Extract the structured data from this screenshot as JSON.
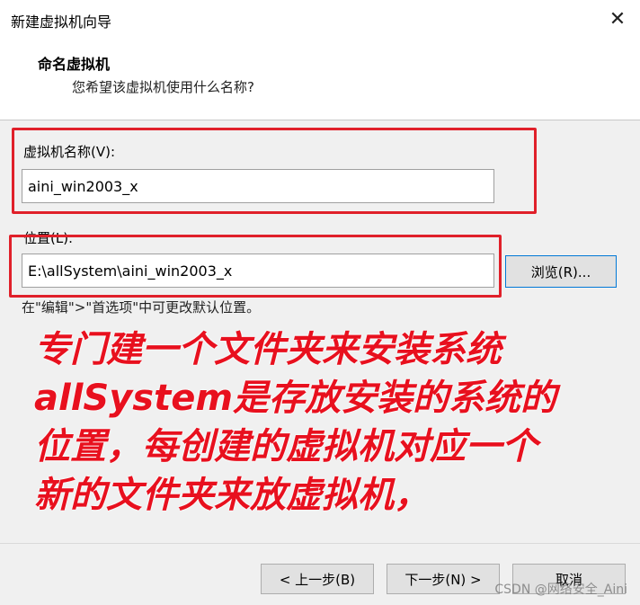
{
  "window": {
    "title": "新建虚拟机向导",
    "close_icon": "close-icon"
  },
  "header": {
    "title": "命名虚拟机",
    "subtitle": "您希望该虚拟机使用什么名称?"
  },
  "form": {
    "name_label": "虚拟机名称(V):",
    "name_value": "aini_win2003_x",
    "location_label": "位置(L):",
    "location_value": "E:\\allSystem\\aini_win2003_x",
    "browse_label": "浏览(R)...",
    "note": "在\"编辑\">\"首选项\"中可更改默认位置。"
  },
  "annotation": {
    "lines": [
      "专门建一个文件夹来安装系统",
      "allSystem是存放安装的系统的",
      "位置，每创建的虚拟机对应一个",
      "新的文件夹来放虚拟机，"
    ],
    "color": "#e8101e"
  },
  "footer": {
    "back_label": "< 上一步(B)",
    "next_label": "下一步(N) >",
    "cancel_label": "取消"
  },
  "watermark": "CSDN @网络安全_Aini",
  "colors": {
    "highlight_box": "#e0202a",
    "dialog_bg": "#f0f0f0"
  }
}
